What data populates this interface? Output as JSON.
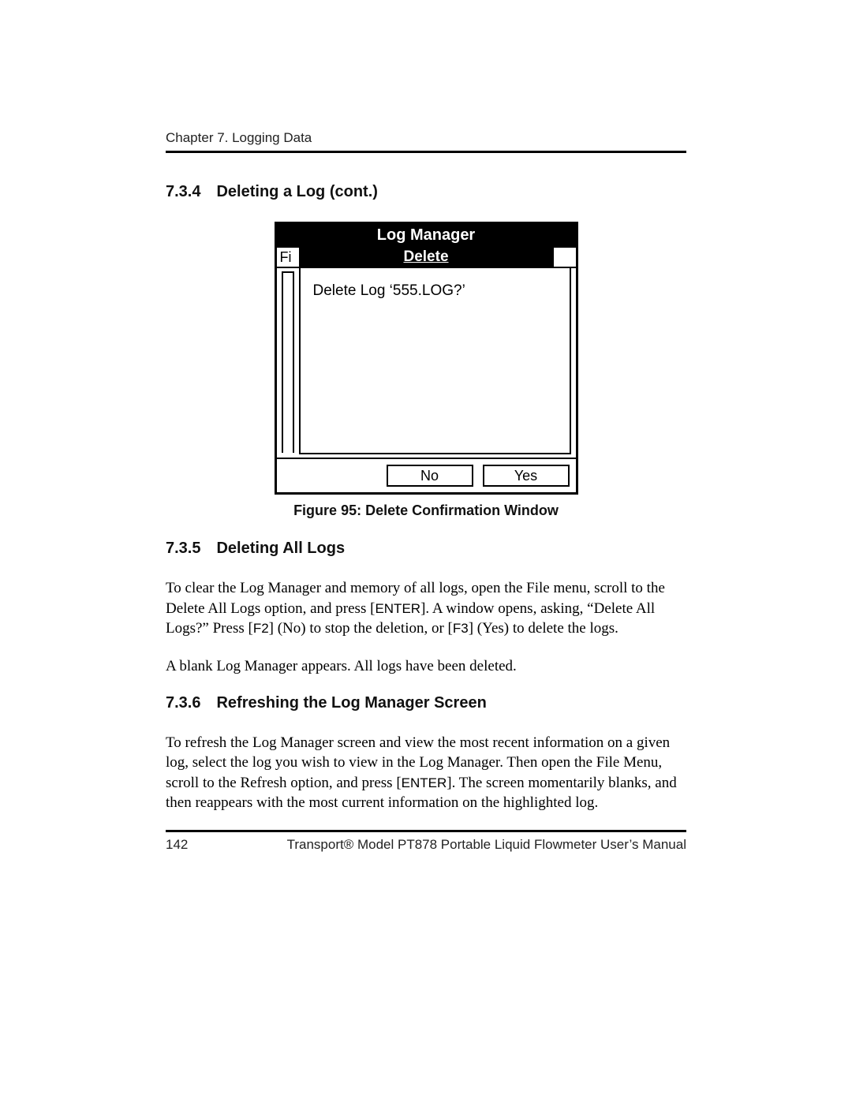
{
  "chapter_header": "Chapter 7. Logging Data",
  "section_734": {
    "num": "7.3.4",
    "title": "Deleting a Log (cont.)"
  },
  "screen": {
    "title": "Log Manager",
    "toolbar_left": "Fi",
    "toolbar_center": "Delete",
    "dialog_text": "Delete Log ‘555.LOG?’",
    "btn_no": "No",
    "btn_yes": "Yes"
  },
  "figure_caption": "Figure 95: Delete Confirmation Window",
  "section_735": {
    "num": "7.3.5",
    "title": "Deleting All Logs"
  },
  "para_735_1_a": "To clear the Log Manager and memory of all logs, open the File menu, scroll to the Delete All Logs option, and press [",
  "para_735_1_key1": "ENTER",
  "para_735_1_b": "]. A window opens, asking, “Delete All Logs?” Press [",
  "para_735_1_key2": "F2",
  "para_735_1_c": "] (No) to stop the deletion, or [",
  "para_735_1_key3": "F3",
  "para_735_1_d": "] (Yes) to delete the logs.",
  "para_735_2": "A blank Log Manager appears. All logs have been deleted.",
  "section_736": {
    "num": "7.3.6",
    "title": "Refreshing the Log Manager Screen"
  },
  "para_736_a": "To refresh the Log Manager screen and view the most recent information on a given log, select the log you wish to view in the Log Manager. Then open the File Menu, scroll to the Refresh option, and press [",
  "para_736_key": "ENTER",
  "para_736_b": "]. The screen momentarily blanks, and then reappears with the most current information on the highlighted log.",
  "footer": {
    "page": "142",
    "title": "Transport® Model PT878 Portable Liquid Flowmeter User’s Manual"
  }
}
